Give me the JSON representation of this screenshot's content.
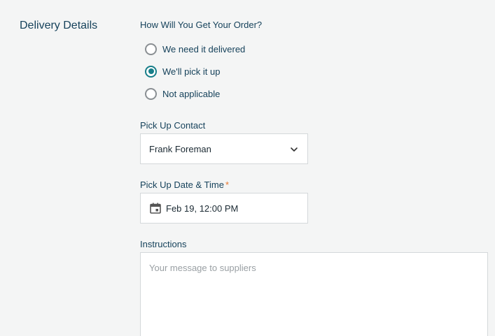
{
  "section": {
    "title": "Delivery Details"
  },
  "delivery_method": {
    "label": "How Will You Get Your Order?",
    "options": [
      {
        "label": "We need it delivered",
        "selected": false
      },
      {
        "label": "We'll pick it up",
        "selected": true
      },
      {
        "label": "Not applicable",
        "selected": false
      }
    ]
  },
  "pickup_contact": {
    "label": "Pick Up Contact",
    "value": "Frank Foreman",
    "icon": "chevron-down-icon"
  },
  "pickup_datetime": {
    "label": "Pick Up Date & Time",
    "required_mark": "*",
    "value": "Feb 19, 12:00 PM",
    "icon": "calendar-icon"
  },
  "instructions": {
    "label": "Instructions",
    "placeholder": "Your message to suppliers",
    "value": ""
  },
  "colors": {
    "accent": "#177e89",
    "label": "#16425b",
    "required": "#e8772e",
    "background": "#f4f5f5"
  }
}
